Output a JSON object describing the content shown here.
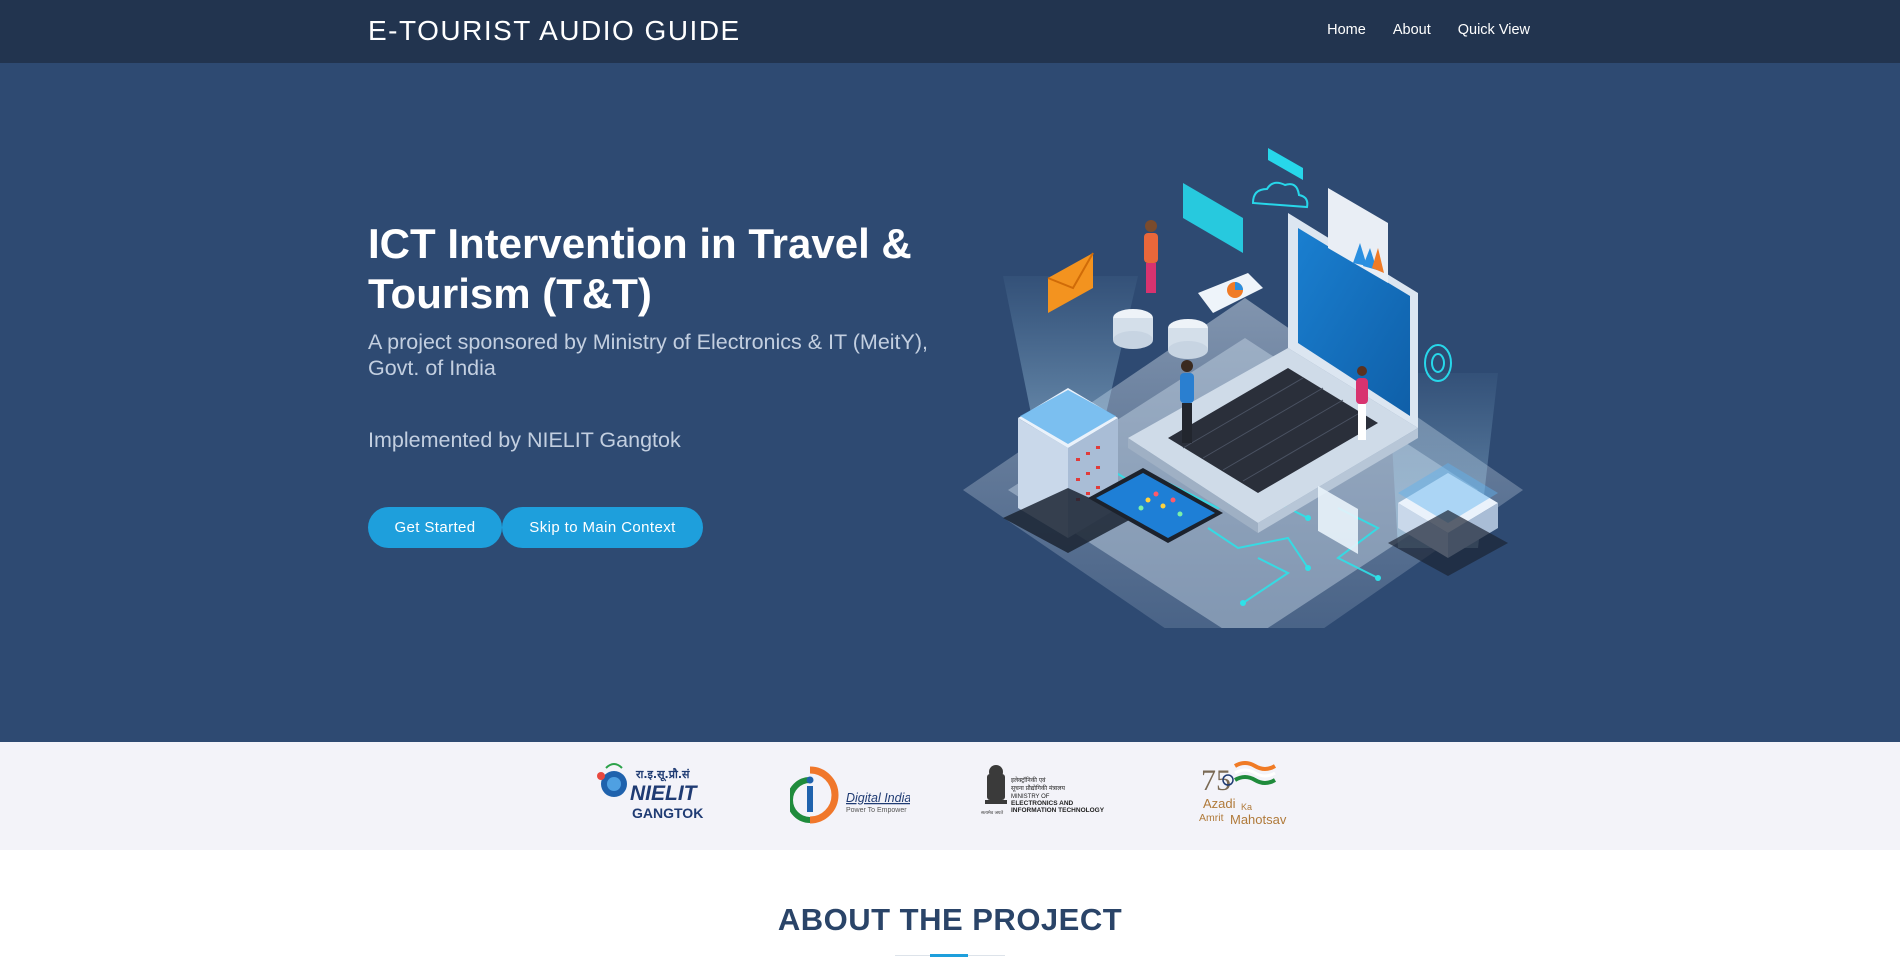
{
  "header": {
    "brand": "E-TOURIST AUDIO GUIDE",
    "nav": [
      "Home",
      "About",
      "Quick View"
    ]
  },
  "hero": {
    "title": "ICT Intervention in Travel & Tourism (T&T)",
    "subtitle": "A project sponsored by Ministry of Electronics & IT (MeitY), Govt. of India",
    "implemented": "Implemented by NIELIT Gangtok",
    "buttons": {
      "get_started": "Get Started",
      "skip": "Skip to Main Context"
    }
  },
  "logos": {
    "nielit": {
      "hindi": "रा.इ.सू.प्रौ.सं",
      "name": "NIELIT",
      "city": "GANGTOK"
    },
    "digital_india": {
      "name": "Digital India",
      "tagline": "Power To Empower"
    },
    "meity": {
      "hindi1": "इलेक्ट्रॉनिकी एवं",
      "hindi2": "सूचना प्रौद्योगिकी मंत्रालय",
      "line1": "MINISTRY OF",
      "line2": "ELECTRONICS AND",
      "line3": "INFORMATION TECHNOLOGY",
      "emblem_text": "सत्यमेव जयते"
    },
    "azadi": {
      "number": "75",
      "azadi": "Azadi",
      "ka": "Ka",
      "amrit": "Amrit",
      "mahotsav": "Mahotsav"
    }
  },
  "about": {
    "title": "ABOUT THE PROJECT"
  },
  "colors": {
    "navbar": "#22344f",
    "hero": "#2e4a72",
    "accent": "#1e9fdc",
    "logos_bg": "#f3f3f9",
    "about_title": "#2a4468"
  },
  "icons": [
    "isometric-laptop-illustration",
    "nielit-logo",
    "digital-india-logo",
    "meity-emblem-logo",
    "azadi-ka-amrit-mahotsav-logo"
  ]
}
